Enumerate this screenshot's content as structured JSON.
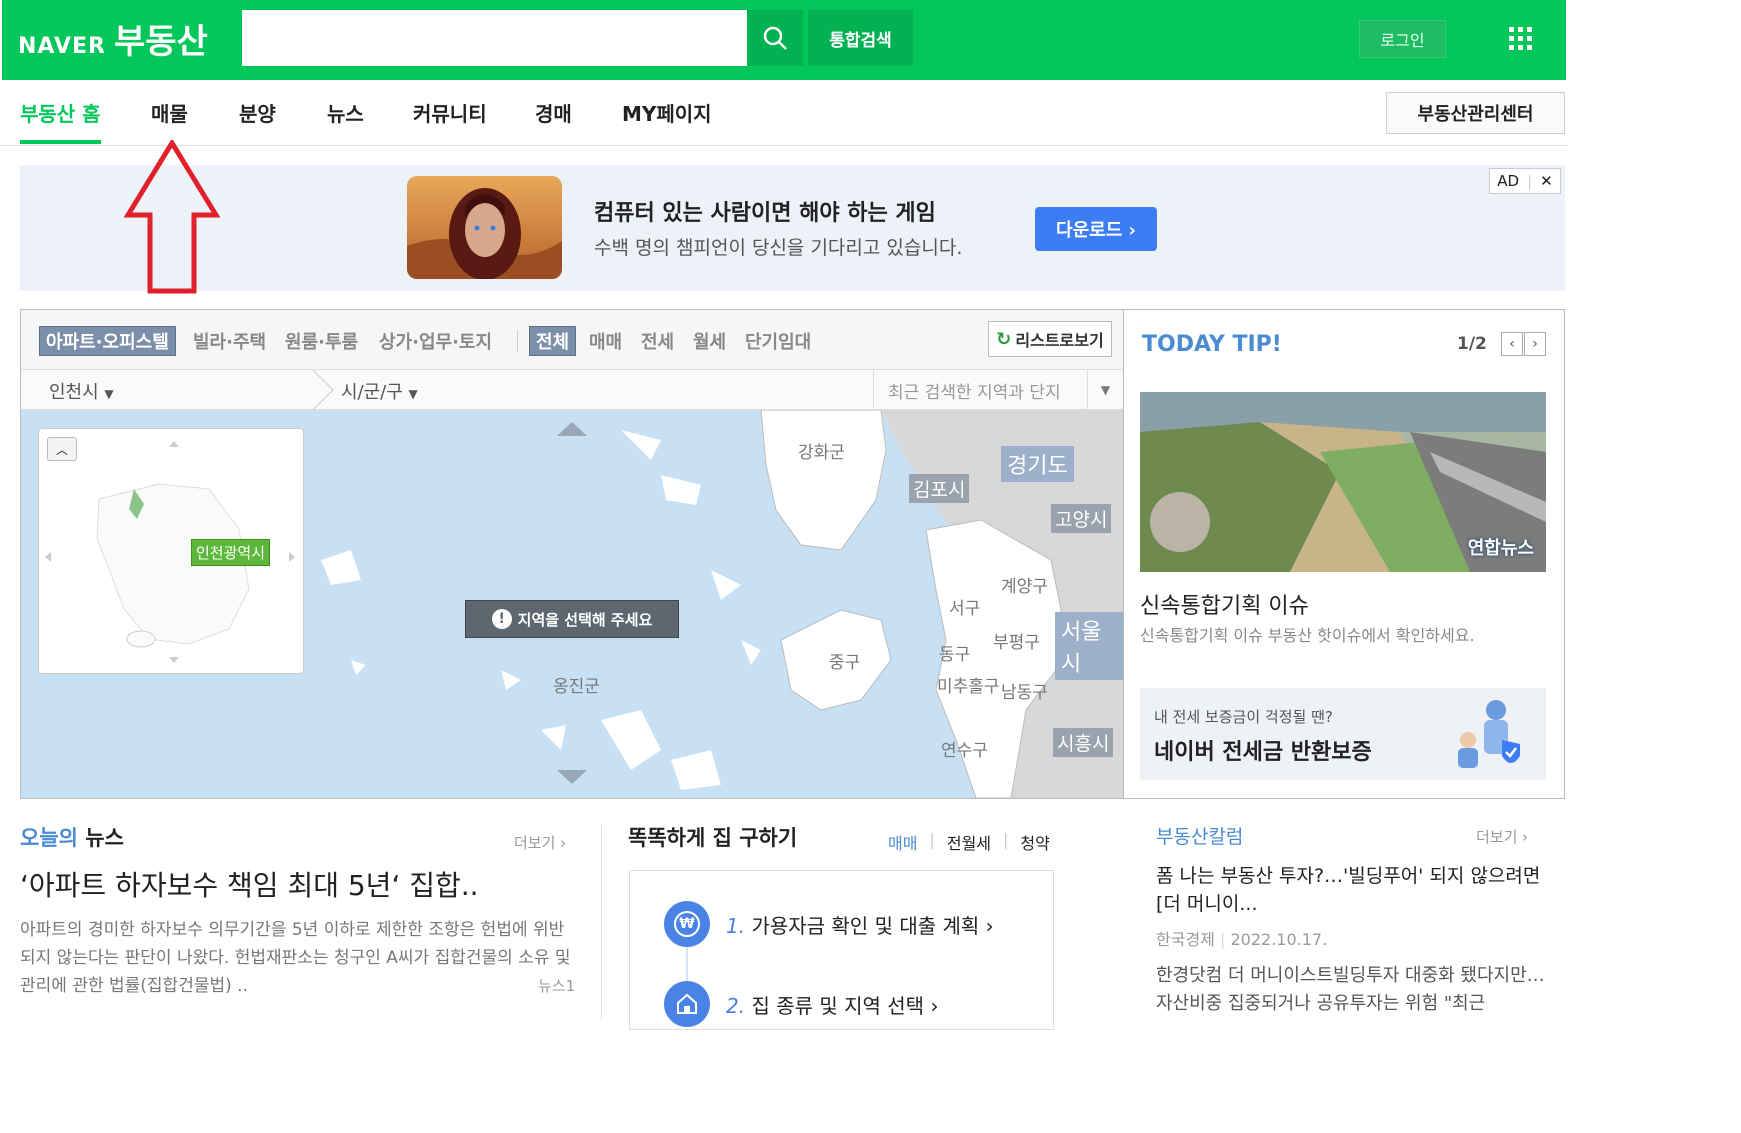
{
  "header": {
    "logo_brand": "NAVER",
    "logo_service": "부동산",
    "search_placeholder": "",
    "unified_search": "통합검색",
    "login": "로그인"
  },
  "nav": {
    "items": [
      "부동산 홈",
      "매물",
      "분양",
      "뉴스",
      "커뮤니티",
      "경매",
      "MY페이지"
    ],
    "active_index": 0,
    "management_center": "부동산관리센터"
  },
  "ad": {
    "title": "컴퓨터 있는 사람이면 해야 하는 게임",
    "description": "수백 명의 챔피언이 당신을 기다리고 있습니다.",
    "download": "다운로드 ›",
    "badge": "AD"
  },
  "map_panel": {
    "property_types": [
      "아파트·오피스텔",
      "빌라·주택",
      "원룸·투룸",
      "상가·업무·토지"
    ],
    "deal_types": [
      "전체",
      "매매",
      "전세",
      "월세",
      "단기임대"
    ],
    "list_view": "리스트로보기",
    "city": "인천시",
    "district": "시/군/구",
    "recent_search": "최근 검색한 지역과 단지",
    "minimap_label": "인천광역시",
    "toast": "지역을 선택해 주세요",
    "province_label": "경기도",
    "seoul_label": "서울시",
    "city_boxes": [
      "김포시",
      "고양시",
      "시흥시"
    ],
    "regions": [
      "강화군",
      "계양구",
      "서구",
      "부평구",
      "동구",
      "중구",
      "미추홀구",
      "남동구",
      "옹진군",
      "연수구"
    ]
  },
  "tip": {
    "title": "TODAY TIP!",
    "page": "1/2",
    "photo_watermark": "연합뉴스",
    "headline": "신속통합기획 이슈",
    "description": "신속통합기획 이슈 부동산 핫이슈에서 확인하세요.",
    "banner_sub": "내 전세 보증금이 걱정될 땐?",
    "banner_main": "네이버 전세금 반환보증"
  },
  "news": {
    "head_accent": "오늘의",
    "head_rest": " 뉴스",
    "more": "더보기 ›",
    "title": "‘아파트 하자보수 책임 최대 5년‘ 집합..",
    "body": "아파트의 경미한 하자보수 의무기간을 5년 이하로 제한한 조항은 헌법에 위반되지 않는다는 판단이 나왔다. 헌법재판소는 청구인 A씨가 집합건물의 소유 및 관리에 관한 법률(집합건물법) ..",
    "source": "뉴스1"
  },
  "smart": {
    "head": "똑똑하게 집 구하기",
    "tabs": [
      "매매",
      "전월세",
      "청약"
    ],
    "steps": [
      {
        "num": "1.",
        "text": "가용자금 확인 및 대출 계획 ›"
      },
      {
        "num": "2.",
        "text": "집 종류 및 지역 선택 ›"
      }
    ]
  },
  "column": {
    "head": "부동산칼럼",
    "more": "더보기 ›",
    "title": "폼 나는 부동산 투자?…'빌딩푸어' 되지 않으려면 [더 머니이...",
    "source": "한국경제",
    "date": "2022.10.17.",
    "body": "한경닷컴 더 머니이스트빌딩투자 대중화 됐다지만…자산비중 집중되거나 공유투자는 위험 \"최근"
  },
  "colors": {
    "brand": "#03c75a",
    "accent_blue": "#4a8bd1",
    "arrow": "#e0202a"
  }
}
